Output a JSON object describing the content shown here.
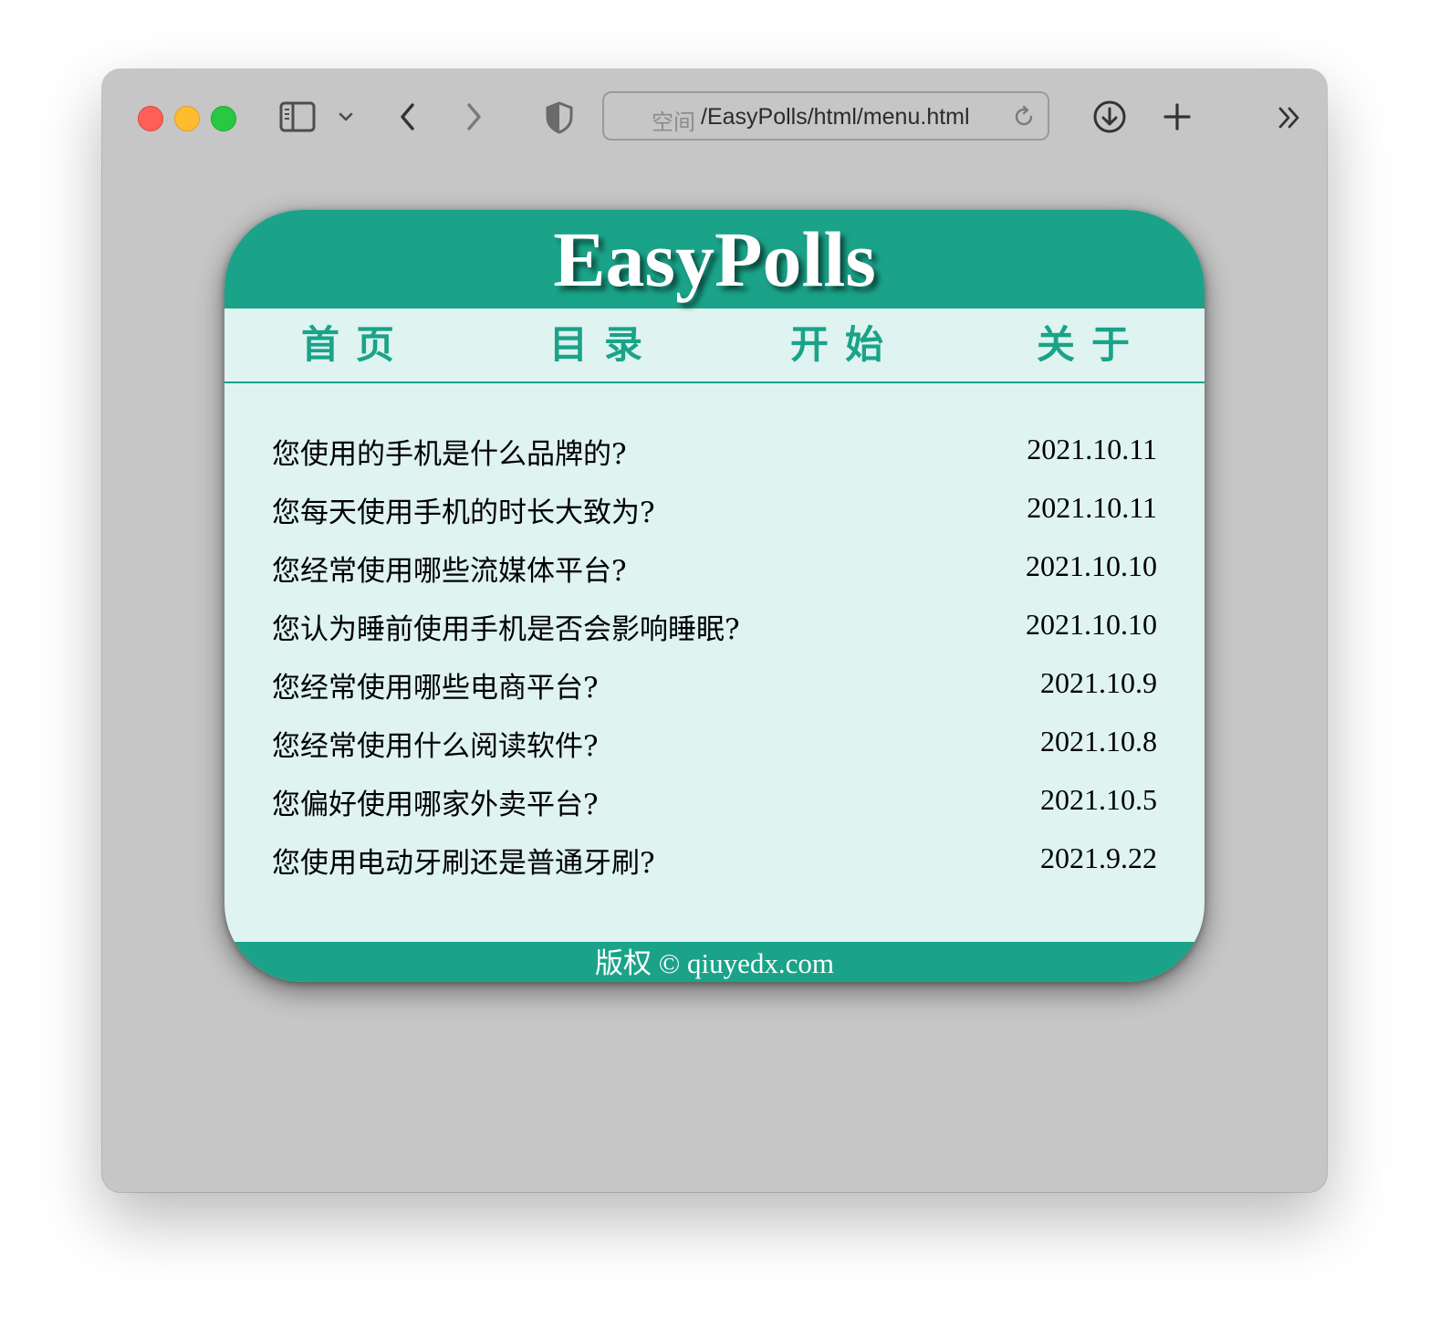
{
  "browser": {
    "url_prefix": "空间",
    "url_path": "/EasyPolls/html/menu.html",
    "accent_color": "#1aa389"
  },
  "site": {
    "title": "EasyPolls",
    "nav": [
      "首页",
      "目录",
      "开始",
      "关于"
    ],
    "polls": [
      {
        "question": "您使用的手机是什么品牌的?",
        "date": "2021.10.11"
      },
      {
        "question": "您每天使用手机的时长大致为?",
        "date": "2021.10.11"
      },
      {
        "question": "您经常使用哪些流媒体平台?",
        "date": "2021.10.10"
      },
      {
        "question": "您认为睡前使用手机是否会影响睡眠?",
        "date": "2021.10.10"
      },
      {
        "question": "您经常使用哪些电商平台?",
        "date": "2021.10.9"
      },
      {
        "question": "您经常使用什么阅读软件?",
        "date": "2021.10.8"
      },
      {
        "question": "您偏好使用哪家外卖平台?",
        "date": "2021.10.5"
      },
      {
        "question": "您使用电动牙刷还是普通牙刷?",
        "date": "2021.9.22"
      }
    ],
    "footer": "版权 © qiuyedx.com"
  }
}
